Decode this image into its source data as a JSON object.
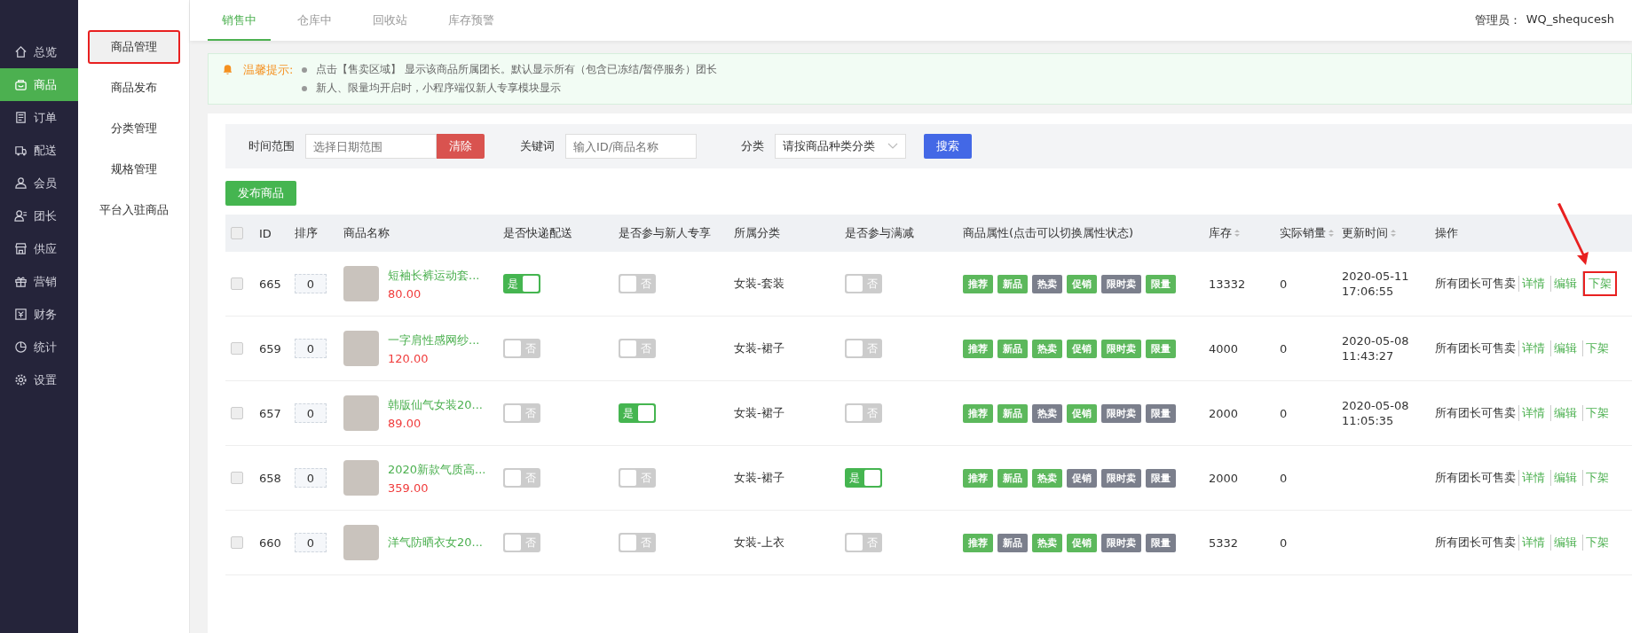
{
  "sidebar": {
    "items": [
      {
        "label": "总览",
        "selected": false
      },
      {
        "label": "商品",
        "selected": true
      },
      {
        "label": "订单",
        "selected": false
      },
      {
        "label": "配送",
        "selected": false
      },
      {
        "label": "会员",
        "selected": false
      },
      {
        "label": "团长",
        "selected": false
      },
      {
        "label": "供应",
        "selected": false
      },
      {
        "label": "营销",
        "selected": false
      },
      {
        "label": "财务",
        "selected": false
      },
      {
        "label": "统计",
        "selected": false
      },
      {
        "label": "设置",
        "selected": false
      }
    ]
  },
  "submenu": {
    "items": [
      {
        "label": "商品管理",
        "selected": true,
        "annotated": true
      },
      {
        "label": "商品发布",
        "selected": false,
        "annotated": false
      },
      {
        "label": "分类管理",
        "selected": false,
        "annotated": false
      },
      {
        "label": "规格管理",
        "selected": false,
        "annotated": false
      },
      {
        "label": "平台入驻商品",
        "selected": false,
        "annotated": false
      }
    ]
  },
  "tabs": [
    {
      "label": "销售中",
      "selected": true
    },
    {
      "label": "仓库中",
      "selected": false
    },
    {
      "label": "回收站",
      "selected": false
    },
    {
      "label": "库存预警",
      "selected": false
    }
  ],
  "admin": {
    "label": "管理员：",
    "name": "WQ_shequcesh"
  },
  "notice": {
    "title": "温馨提示:",
    "lines": [
      "点击【售卖区域】 显示该商品所属团长。默认显示所有（包含已冻结/暂停服务）团长",
      "新人、限量均开启时，小程序端仅新人专享模块显示"
    ]
  },
  "filters": {
    "time_label": "时间范围",
    "time_placeholder": "选择日期范围",
    "clear_button": "清除",
    "keyword_label": "关键词",
    "keyword_placeholder": "输入ID/商品名称",
    "category_label": "分类",
    "category_value": "请按商品种类分类",
    "search_button": "搜索"
  },
  "publish_button": "发布商品",
  "table": {
    "select_all_checked": false,
    "columns": [
      {
        "label": "ID",
        "sortable": false
      },
      {
        "label": "排序",
        "sortable": false
      },
      {
        "label": "商品名称",
        "sortable": false
      },
      {
        "label": "是否快递配送",
        "sortable": false
      },
      {
        "label": "是否参与新人专享",
        "sortable": false
      },
      {
        "label": "所属分类",
        "sortable": false
      },
      {
        "label": "是否参与满减",
        "sortable": false
      },
      {
        "label": "商品属性(点击可以切换属性状态)",
        "sortable": false
      },
      {
        "label": "库存",
        "sortable": true
      },
      {
        "label": "实际销量",
        "sortable": true
      },
      {
        "label": "更新时间",
        "sortable": true
      },
      {
        "label": "操作",
        "sortable": false
      }
    ],
    "rows": [
      {
        "checked": false,
        "id": "665",
        "sort": "0",
        "name": "短袖长裤运动套...",
        "price": "80.00",
        "express": {
          "label": "是",
          "on": true
        },
        "newbie": {
          "label": "否",
          "on": false
        },
        "category": "女装-套装",
        "discount": {
          "label": "否",
          "on": false
        },
        "tags": [
          {
            "label": "推荐",
            "on": true
          },
          {
            "label": "新品",
            "on": true
          },
          {
            "label": "热卖",
            "on": false
          },
          {
            "label": "促销",
            "on": true
          },
          {
            "label": "限时卖",
            "on": false
          },
          {
            "label": "限量",
            "on": true
          }
        ],
        "stock": "13332",
        "sales": "0",
        "date": "2020-05-11",
        "time": "17:06:55",
        "scope": "所有团长可售卖",
        "actions": [
          "详情",
          "编辑",
          "下架"
        ],
        "annotated": true
      },
      {
        "checked": false,
        "id": "659",
        "sort": "0",
        "name": "一字肩性感网纱...",
        "price": "120.00",
        "express": {
          "label": "否",
          "on": false
        },
        "newbie": {
          "label": "否",
          "on": false
        },
        "category": "女装-裙子",
        "discount": {
          "label": "否",
          "on": false
        },
        "tags": [
          {
            "label": "推荐",
            "on": true
          },
          {
            "label": "新品",
            "on": true
          },
          {
            "label": "热卖",
            "on": true
          },
          {
            "label": "促销",
            "on": true
          },
          {
            "label": "限时卖",
            "on": true
          },
          {
            "label": "限量",
            "on": true
          }
        ],
        "stock": "4000",
        "sales": "0",
        "date": "2020-05-08",
        "time": "11:43:27",
        "scope": "所有团长可售卖",
        "actions": [
          "详情",
          "编辑",
          "下架"
        ],
        "annotated": false
      },
      {
        "checked": false,
        "id": "657",
        "sort": "0",
        "name": "韩版仙气女装20...",
        "price": "89.00",
        "express": {
          "label": "否",
          "on": false
        },
        "newbie": {
          "label": "是",
          "on": true
        },
        "category": "女装-裙子",
        "discount": {
          "label": "否",
          "on": false
        },
        "tags": [
          {
            "label": "推荐",
            "on": true
          },
          {
            "label": "新品",
            "on": true
          },
          {
            "label": "热卖",
            "on": false
          },
          {
            "label": "促销",
            "on": true
          },
          {
            "label": "限时卖",
            "on": false
          },
          {
            "label": "限量",
            "on": false
          }
        ],
        "stock": "2000",
        "sales": "0",
        "date": "2020-05-08",
        "time": "11:05:35",
        "scope": "所有团长可售卖",
        "actions": [
          "详情",
          "编辑",
          "下架"
        ],
        "annotated": false
      },
      {
        "checked": false,
        "id": "658",
        "sort": "0",
        "name": "2020新款气质高...",
        "price": "359.00",
        "express": {
          "label": "否",
          "on": false
        },
        "newbie": {
          "label": "否",
          "on": false
        },
        "category": "女装-裙子",
        "discount": {
          "label": "是",
          "on": true
        },
        "tags": [
          {
            "label": "推荐",
            "on": true
          },
          {
            "label": "新品",
            "on": true
          },
          {
            "label": "热卖",
            "on": true
          },
          {
            "label": "促销",
            "on": false
          },
          {
            "label": "限时卖",
            "on": false
          },
          {
            "label": "限量",
            "on": false
          }
        ],
        "stock": "2000",
        "sales": "0",
        "scope": "所有团长可售卖",
        "actions": [
          "详情",
          "编辑",
          "下架"
        ],
        "annotated": false
      },
      {
        "checked": false,
        "id": "660",
        "sort": "0",
        "name": "洋气防晒衣女20...",
        "express": {
          "label": "否",
          "on": false
        },
        "newbie": {
          "label": "否",
          "on": false
        },
        "category": "女装-上衣",
        "discount": {
          "label": "否",
          "on": false
        },
        "tags": [
          {
            "label": "推荐",
            "on": true
          },
          {
            "label": "新品",
            "on": false
          },
          {
            "label": "热卖",
            "on": true
          },
          {
            "label": "促销",
            "on": true
          },
          {
            "label": "限时卖",
            "on": false
          },
          {
            "label": "限量",
            "on": false
          }
        ],
        "stock": "5332",
        "sales": "0",
        "scope": "所有团长可售卖",
        "actions": [
          "详情",
          "编辑",
          "下架"
        ],
        "annotated": false
      }
    ]
  }
}
